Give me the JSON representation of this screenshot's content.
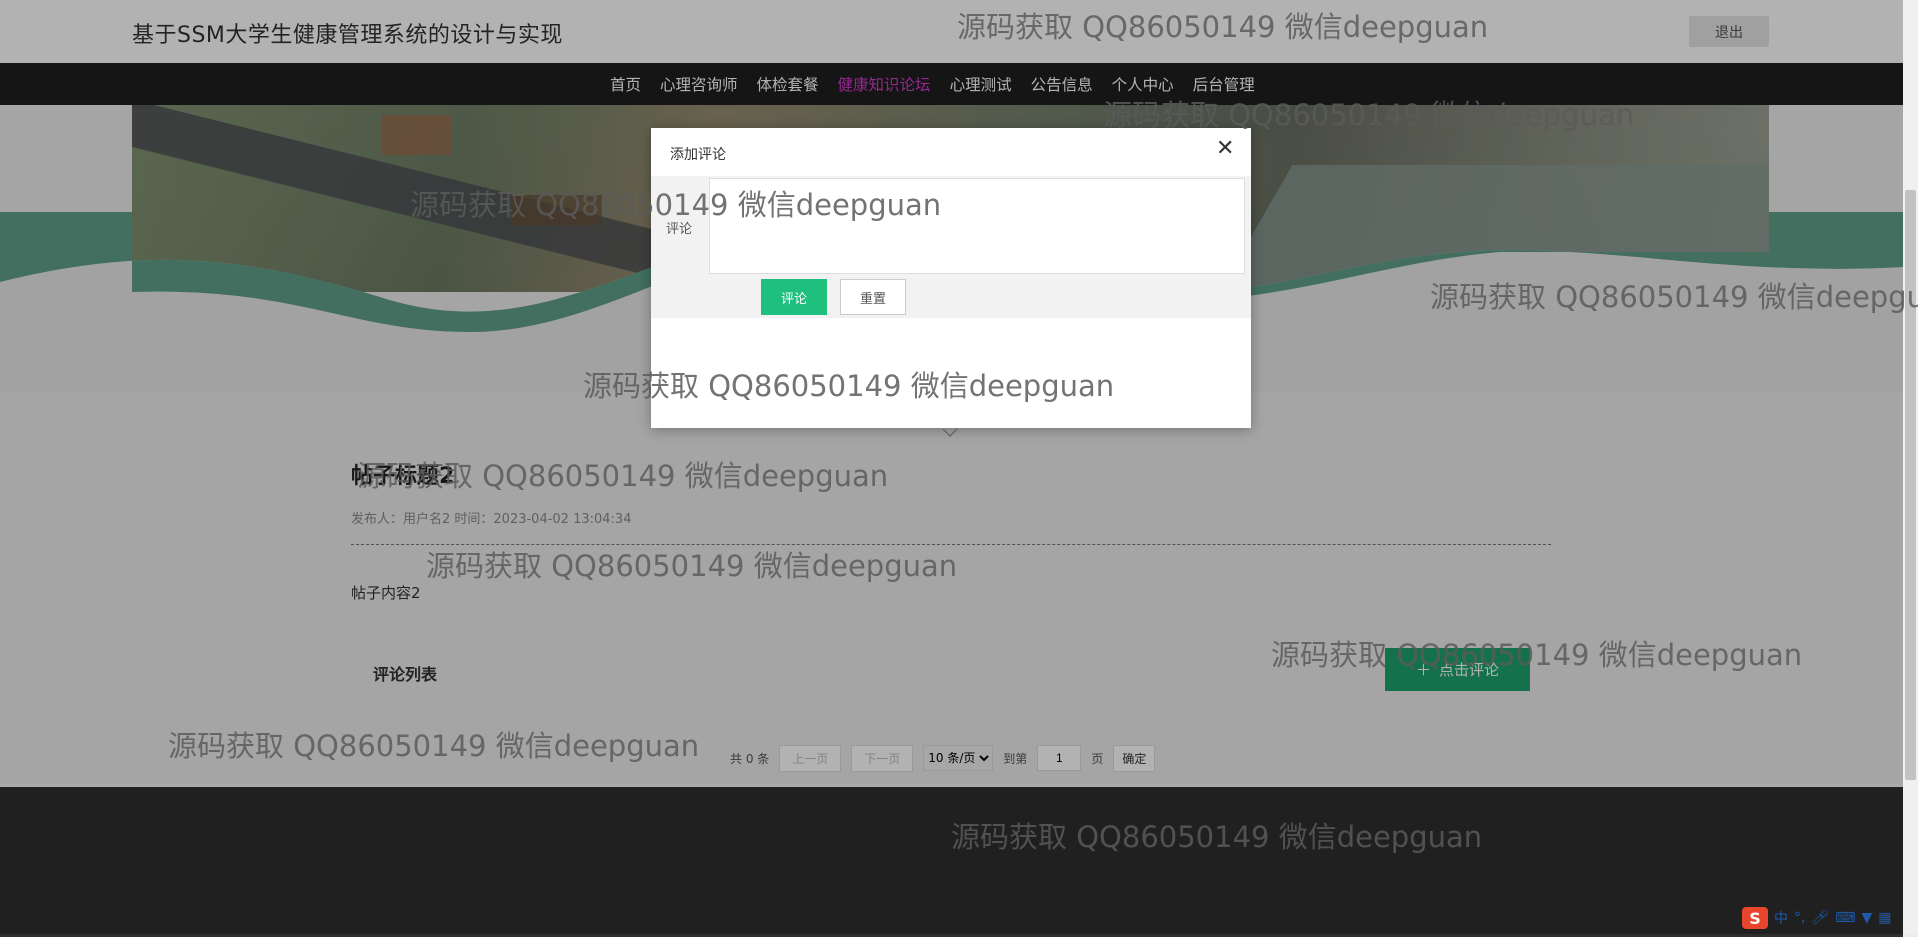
{
  "header": {
    "site_title": "基于SSM大学生健康管理系统的设计与实现",
    "logout_label": "退出"
  },
  "nav": {
    "items": [
      "首页",
      "心理咨询师",
      "体检套餐",
      "健康知识论坛",
      "心理测试",
      "公告信息",
      "个人中心",
      "后台管理"
    ],
    "active_index": 3,
    "active_color": "#d63ad2"
  },
  "post": {
    "title": "帖子标题2",
    "meta": "发布人：用户名2 时间：2023-04-02 13:04:34",
    "content": "帖子内容2",
    "comment_list_title": "评论列表",
    "comment_button_label": "点击评论",
    "comment_button_icon": "plus-icon"
  },
  "pagination": {
    "total": "共 0 条",
    "prev": "上一页",
    "next": "下一页",
    "page_size_selected": "10 条/页",
    "goto_label": "到第",
    "page_value": "1",
    "page_unit": "页",
    "confirm": "确定"
  },
  "modal": {
    "title": "添加评论",
    "close_icon": "close-icon",
    "field_label": "评论",
    "textarea_value": "",
    "submit_label": "评论",
    "reset_label": "重置"
  },
  "watermark": "源码获取 QQ86050149 微信deepguan",
  "ime": {
    "mode": "中",
    "icons": [
      "sogou-logo-icon",
      "punctuation-icon",
      "microphone-icon",
      "keyboard-icon",
      "skin-icon",
      "toolbox-icon"
    ]
  },
  "colors": {
    "accent_green": "#1fa36d",
    "wave_green": "#5f9f8a",
    "nav_bg": "#1f1f1f"
  }
}
